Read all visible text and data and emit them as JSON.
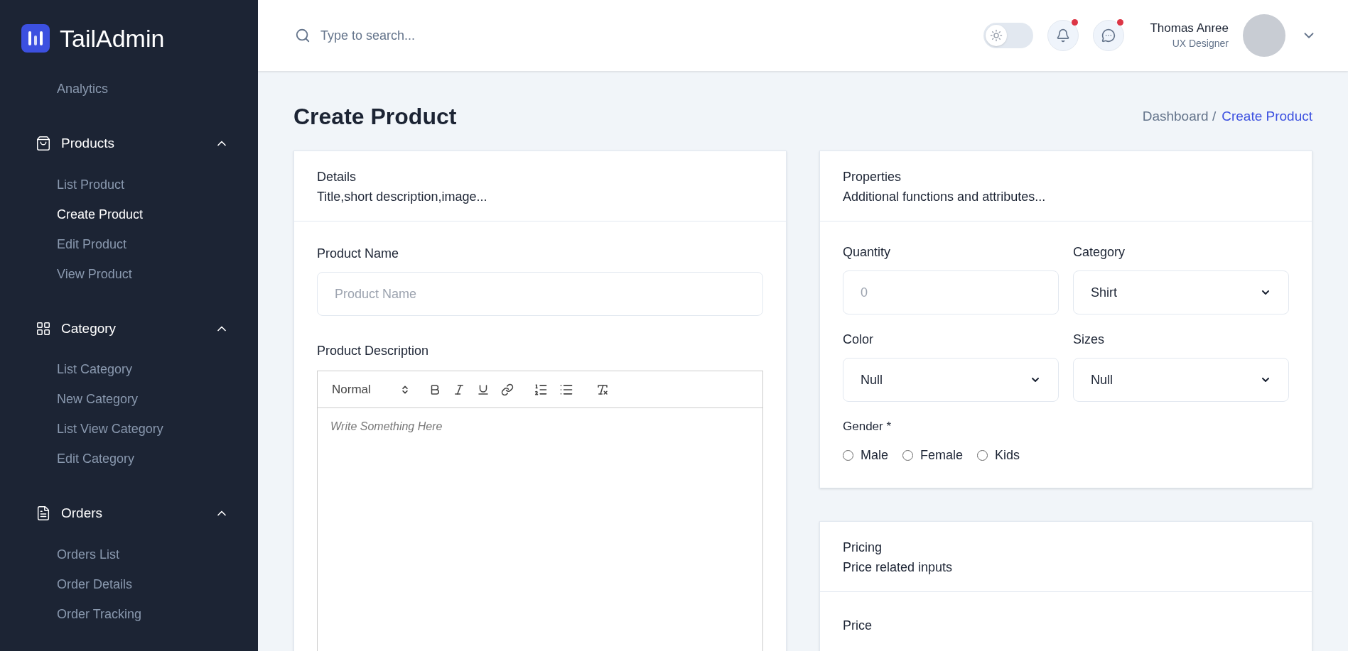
{
  "brand": {
    "name": "TailAdmin"
  },
  "sidebar": {
    "top_items": [
      {
        "label": "Analytics",
        "selected": false
      }
    ],
    "groups": [
      {
        "label": "Products",
        "expanded": true,
        "items": [
          {
            "label": "List Product",
            "selected": false
          },
          {
            "label": "Create Product",
            "selected": true
          },
          {
            "label": "Edit Product",
            "selected": false
          },
          {
            "label": "View Product",
            "selected": false
          }
        ]
      },
      {
        "label": "Category",
        "expanded": true,
        "items": [
          {
            "label": "List Category",
            "selected": false
          },
          {
            "label": "New Category",
            "selected": false
          },
          {
            "label": "List View Category",
            "selected": false
          },
          {
            "label": "Edit Category",
            "selected": false
          }
        ]
      },
      {
        "label": "Orders",
        "expanded": true,
        "items": [
          {
            "label": "Orders List",
            "selected": false
          },
          {
            "label": "Order Details",
            "selected": false
          },
          {
            "label": "Order Tracking",
            "selected": false
          }
        ]
      }
    ]
  },
  "header": {
    "search": {
      "placeholder": "Type to search..."
    },
    "dark_mode": {
      "on": false
    },
    "notifications": {
      "unread": true
    },
    "messages": {
      "unread": true
    },
    "user": {
      "name": "Thomas Anree",
      "role": "UX Designer"
    }
  },
  "page": {
    "title": "Create Product",
    "breadcrumb": [
      {
        "label": "Dashboard /",
        "selected": false
      },
      {
        "label": "Create Product",
        "selected": true
      }
    ]
  },
  "details": {
    "title": "Details",
    "subtitle": "Title,short description,image...",
    "product_name": {
      "label": "Product Name",
      "placeholder": "Product Name"
    },
    "description": {
      "label": "Product Description",
      "format": "Normal",
      "placeholder": "Write Something Here"
    }
  },
  "properties": {
    "title": "Properties",
    "subtitle": "Additional functions and attributes...",
    "fields": [
      {
        "kind": "input",
        "label": "Quantity",
        "placeholder": "0"
      },
      {
        "kind": "select",
        "label": "Category",
        "value": "Shirt"
      },
      {
        "kind": "select",
        "label": "Color",
        "value": "Null"
      },
      {
        "kind": "select",
        "label": "Sizes",
        "value": "Null"
      }
    ],
    "gender": {
      "label": "Gender *",
      "options": [
        {
          "label": "Male",
          "selected": false
        },
        {
          "label": "Female",
          "selected": false
        },
        {
          "label": "Kids",
          "selected": false
        }
      ]
    }
  },
  "pricing": {
    "title": "Pricing",
    "subtitle": "Price related inputs",
    "price": {
      "label": "Price"
    }
  }
}
